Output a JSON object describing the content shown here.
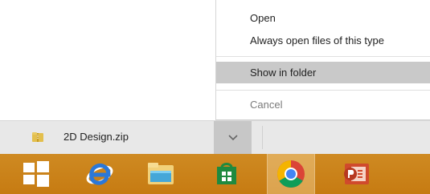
{
  "context_menu": {
    "items": [
      {
        "label": "Open"
      },
      {
        "label": "Always open files of this type"
      },
      {
        "label": "Show in folder"
      },
      {
        "label": "Cancel"
      }
    ]
  },
  "download_shelf": {
    "file_name": "2D Design.zip",
    "file_icon": "zip-folder-icon",
    "dropdown_icon": "chevron-down-icon"
  },
  "taskbar": {
    "apps": [
      {
        "name": "windows-start",
        "icon": "windows-logo-icon"
      },
      {
        "name": "internet-explorer",
        "icon": "internet-explorer-icon"
      },
      {
        "name": "file-explorer",
        "icon": "folder-icon"
      },
      {
        "name": "windows-store",
        "icon": "store-icon"
      },
      {
        "name": "google-chrome",
        "icon": "chrome-icon",
        "active": true
      },
      {
        "name": "powerpoint",
        "icon": "powerpoint-icon"
      }
    ]
  },
  "colors": {
    "menu_highlight": "#c9c9c9",
    "download_bar": "#e8e8e8",
    "taskbar": "#c67b12",
    "chrome_active": "#e7b46a"
  }
}
